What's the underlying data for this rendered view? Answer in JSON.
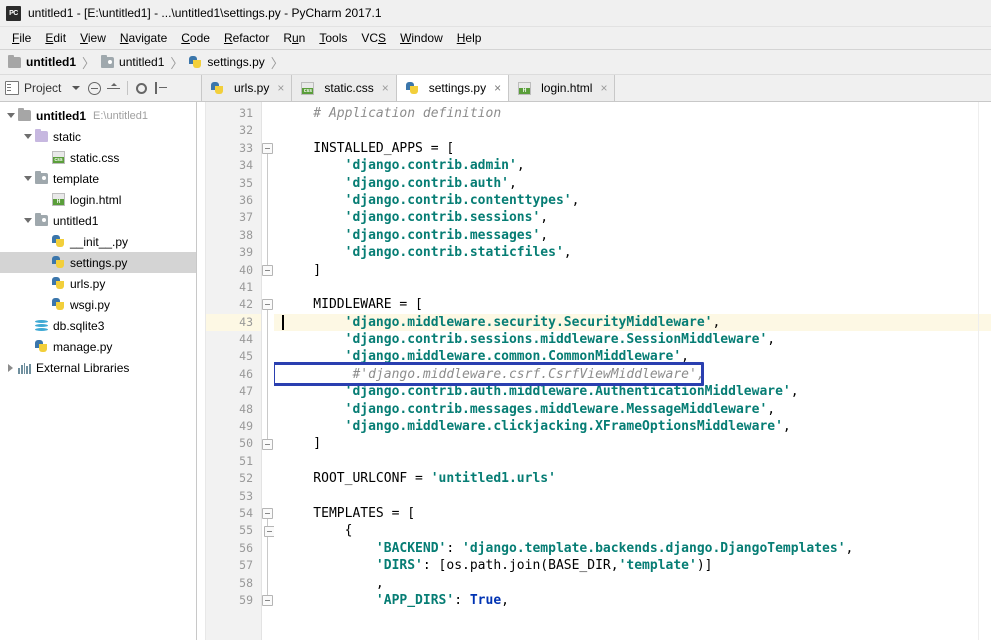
{
  "window": {
    "title": "untitled1 - [E:\\untitled1] - ...\\untitled1\\settings.py - PyCharm 2017.1",
    "logo_text": "PC",
    "logo_icon": "pycharm-logo-icon"
  },
  "menubar": {
    "items": [
      {
        "label": "File",
        "mnemonic": "F"
      },
      {
        "label": "Edit",
        "mnemonic": "E"
      },
      {
        "label": "View",
        "mnemonic": "V"
      },
      {
        "label": "Navigate",
        "mnemonic": "N"
      },
      {
        "label": "Code",
        "mnemonic": "C"
      },
      {
        "label": "Refactor",
        "mnemonic": "R"
      },
      {
        "label": "Run",
        "mnemonic": "u"
      },
      {
        "label": "Tools",
        "mnemonic": "T"
      },
      {
        "label": "VCS",
        "mnemonic": "S"
      },
      {
        "label": "Window",
        "mnemonic": "W"
      },
      {
        "label": "Help",
        "mnemonic": "H"
      }
    ]
  },
  "breadcrumb": {
    "items": [
      {
        "label": "untitled1",
        "icon": "folder-icon",
        "bold": true
      },
      {
        "label": "untitled1",
        "icon": "source-folder-icon",
        "bold": false
      },
      {
        "label": "settings.py",
        "icon": "python-file-icon",
        "bold": false
      }
    ],
    "separator": "〉"
  },
  "project_toolbar": {
    "label": "Project",
    "icons": [
      "project-view-icon",
      "chevron-down-icon",
      "collapse-all-icon",
      "expand-all-icon",
      "gear-icon",
      "hide-panel-icon"
    ]
  },
  "editor_tabs": [
    {
      "label": "urls.py",
      "icon": "python-file-icon",
      "active": false,
      "close": "×"
    },
    {
      "label": "static.css",
      "icon": "css-file-icon",
      "active": false,
      "close": "×"
    },
    {
      "label": "settings.py",
      "icon": "python-file-icon",
      "active": true,
      "close": "×"
    },
    {
      "label": "login.html",
      "icon": "html-file-icon",
      "active": false,
      "close": "×"
    }
  ],
  "project_tree": [
    {
      "label": "untitled1",
      "sub": "E:\\untitled1",
      "icon": "folder-icon",
      "indent": 0,
      "twisty": "open",
      "bold": true,
      "selected": false
    },
    {
      "label": "static",
      "sub": "",
      "icon": "folder-purple-icon",
      "indent": 1,
      "twisty": "open",
      "bold": false,
      "selected": false
    },
    {
      "label": "static.css",
      "sub": "",
      "icon": "css-file-icon",
      "indent": 2,
      "twisty": "none",
      "bold": false,
      "selected": false
    },
    {
      "label": "template",
      "sub": "",
      "icon": "source-folder-icon",
      "indent": 1,
      "twisty": "open",
      "bold": false,
      "selected": false
    },
    {
      "label": "login.html",
      "sub": "",
      "icon": "html-file-icon",
      "indent": 2,
      "twisty": "none",
      "bold": false,
      "selected": false
    },
    {
      "label": "untitled1",
      "sub": "",
      "icon": "source-folder-icon",
      "indent": 1,
      "twisty": "open",
      "bold": false,
      "selected": false
    },
    {
      "label": "__init__.py",
      "sub": "",
      "icon": "python-file-icon",
      "indent": 2,
      "twisty": "none",
      "bold": false,
      "selected": false
    },
    {
      "label": "settings.py",
      "sub": "",
      "icon": "python-file-icon",
      "indent": 2,
      "twisty": "none",
      "bold": false,
      "selected": true
    },
    {
      "label": "urls.py",
      "sub": "",
      "icon": "python-file-icon",
      "indent": 2,
      "twisty": "none",
      "bold": false,
      "selected": false
    },
    {
      "label": "wsgi.py",
      "sub": "",
      "icon": "python-file-icon",
      "indent": 2,
      "twisty": "none",
      "bold": false,
      "selected": false
    },
    {
      "label": "db.sqlite3",
      "sub": "",
      "icon": "database-icon",
      "indent": 1,
      "twisty": "none",
      "bold": false,
      "selected": false
    },
    {
      "label": "manage.py",
      "sub": "",
      "icon": "python-file-icon",
      "indent": 1,
      "twisty": "none",
      "bold": false,
      "selected": false
    },
    {
      "label": "External Libraries",
      "sub": "",
      "icon": "library-icon",
      "indent": 0,
      "twisty": "closed",
      "bold": false,
      "selected": false
    }
  ],
  "editor": {
    "filename": "settings.py",
    "first_visible_line": 30,
    "current_line": 43,
    "annotated_line": 46,
    "annotation_color": "#2a3fb0",
    "current_line_color": "#fdf8e4",
    "string_color": "#067d74",
    "comment_color": "#8c8c8c",
    "keyword_color": "#0033b3",
    "lines": [
      {
        "n": 31,
        "tokens": [
          {
            "t": "cmt",
            "s": "    # Application definition"
          }
        ]
      },
      {
        "n": 32,
        "tokens": [
          {
            "t": "id",
            "s": ""
          }
        ]
      },
      {
        "n": 33,
        "tokens": [
          {
            "t": "id",
            "s": "    INSTALLED_APPS = ["
          }
        ]
      },
      {
        "n": 34,
        "tokens": [
          {
            "t": "id",
            "s": "        "
          },
          {
            "t": "str",
            "s": "'django.contrib.admin'"
          },
          {
            "t": "punc",
            "s": ","
          }
        ]
      },
      {
        "n": 35,
        "tokens": [
          {
            "t": "id",
            "s": "        "
          },
          {
            "t": "str",
            "s": "'django.contrib.auth'"
          },
          {
            "t": "punc",
            "s": ","
          }
        ]
      },
      {
        "n": 36,
        "tokens": [
          {
            "t": "id",
            "s": "        "
          },
          {
            "t": "str",
            "s": "'django.contrib.contenttypes'"
          },
          {
            "t": "punc",
            "s": ","
          }
        ]
      },
      {
        "n": 37,
        "tokens": [
          {
            "t": "id",
            "s": "        "
          },
          {
            "t": "str",
            "s": "'django.contrib.sessions'"
          },
          {
            "t": "punc",
            "s": ","
          }
        ]
      },
      {
        "n": 38,
        "tokens": [
          {
            "t": "id",
            "s": "        "
          },
          {
            "t": "str",
            "s": "'django.contrib.messages'"
          },
          {
            "t": "punc",
            "s": ","
          }
        ]
      },
      {
        "n": 39,
        "tokens": [
          {
            "t": "id",
            "s": "        "
          },
          {
            "t": "str",
            "s": "'django.contrib.staticfiles'"
          },
          {
            "t": "punc",
            "s": ","
          }
        ]
      },
      {
        "n": 40,
        "tokens": [
          {
            "t": "id",
            "s": "    ]"
          }
        ]
      },
      {
        "n": 41,
        "tokens": [
          {
            "t": "id",
            "s": ""
          }
        ]
      },
      {
        "n": 42,
        "tokens": [
          {
            "t": "id",
            "s": "    MIDDLEWARE = ["
          }
        ]
      },
      {
        "n": 43,
        "tokens": [
          {
            "t": "id",
            "s": "        "
          },
          {
            "t": "str",
            "s": "'django.middleware.security.SecurityMiddleware'"
          },
          {
            "t": "punc",
            "s": ","
          }
        ]
      },
      {
        "n": 44,
        "tokens": [
          {
            "t": "id",
            "s": "        "
          },
          {
            "t": "str",
            "s": "'django.contrib.sessions.middleware.SessionMiddleware'"
          },
          {
            "t": "punc",
            "s": ","
          }
        ]
      },
      {
        "n": 45,
        "tokens": [
          {
            "t": "id",
            "s": "        "
          },
          {
            "t": "str",
            "s": "'django.middleware.common.CommonMiddleware'"
          },
          {
            "t": "punc",
            "s": ","
          }
        ]
      },
      {
        "n": 46,
        "tokens": [
          {
            "t": "cmt",
            "s": "         #'django.middleware.csrf.CsrfViewMiddleware',"
          }
        ]
      },
      {
        "n": 47,
        "tokens": [
          {
            "t": "id",
            "s": "        "
          },
          {
            "t": "str",
            "s": "'django.contrib.auth.middleware.AuthenticationMiddleware'"
          },
          {
            "t": "punc",
            "s": ","
          }
        ]
      },
      {
        "n": 48,
        "tokens": [
          {
            "t": "id",
            "s": "        "
          },
          {
            "t": "str",
            "s": "'django.contrib.messages.middleware.MessageMiddleware'"
          },
          {
            "t": "punc",
            "s": ","
          }
        ]
      },
      {
        "n": 49,
        "tokens": [
          {
            "t": "id",
            "s": "        "
          },
          {
            "t": "str",
            "s": "'django.middleware.clickjacking.XFrameOptionsMiddleware'"
          },
          {
            "t": "punc",
            "s": ","
          }
        ]
      },
      {
        "n": 50,
        "tokens": [
          {
            "t": "id",
            "s": "    ]"
          }
        ]
      },
      {
        "n": 51,
        "tokens": [
          {
            "t": "id",
            "s": ""
          }
        ]
      },
      {
        "n": 52,
        "tokens": [
          {
            "t": "id",
            "s": "    ROOT_URLCONF = "
          },
          {
            "t": "str",
            "s": "'untitled1.urls'"
          }
        ]
      },
      {
        "n": 53,
        "tokens": [
          {
            "t": "id",
            "s": ""
          }
        ]
      },
      {
        "n": 54,
        "tokens": [
          {
            "t": "id",
            "s": "    TEMPLATES = ["
          }
        ]
      },
      {
        "n": 55,
        "tokens": [
          {
            "t": "id",
            "s": "        {"
          }
        ]
      },
      {
        "n": 56,
        "tokens": [
          {
            "t": "id",
            "s": "            "
          },
          {
            "t": "str",
            "s": "'BACKEND'"
          },
          {
            "t": "punc",
            "s": ": "
          },
          {
            "t": "str",
            "s": "'django.template.backends.django.DjangoTemplates'"
          },
          {
            "t": "punc",
            "s": ","
          }
        ]
      },
      {
        "n": 57,
        "tokens": [
          {
            "t": "id",
            "s": "            "
          },
          {
            "t": "str",
            "s": "'DIRS'"
          },
          {
            "t": "punc",
            "s": ": [os.path.join(BASE_DIR,"
          },
          {
            "t": "str",
            "s": "'template'"
          },
          {
            "t": "punc",
            "s": ")]"
          }
        ]
      },
      {
        "n": 58,
        "tokens": [
          {
            "t": "punc",
            "s": "            ,"
          }
        ]
      },
      {
        "n": 59,
        "tokens": [
          {
            "t": "id",
            "s": "            "
          },
          {
            "t": "str",
            "s": "'APP_DIRS'"
          },
          {
            "t": "punc",
            "s": ": "
          },
          {
            "t": "kw",
            "s": "True"
          },
          {
            "t": "punc",
            "s": ","
          }
        ]
      }
    ]
  }
}
